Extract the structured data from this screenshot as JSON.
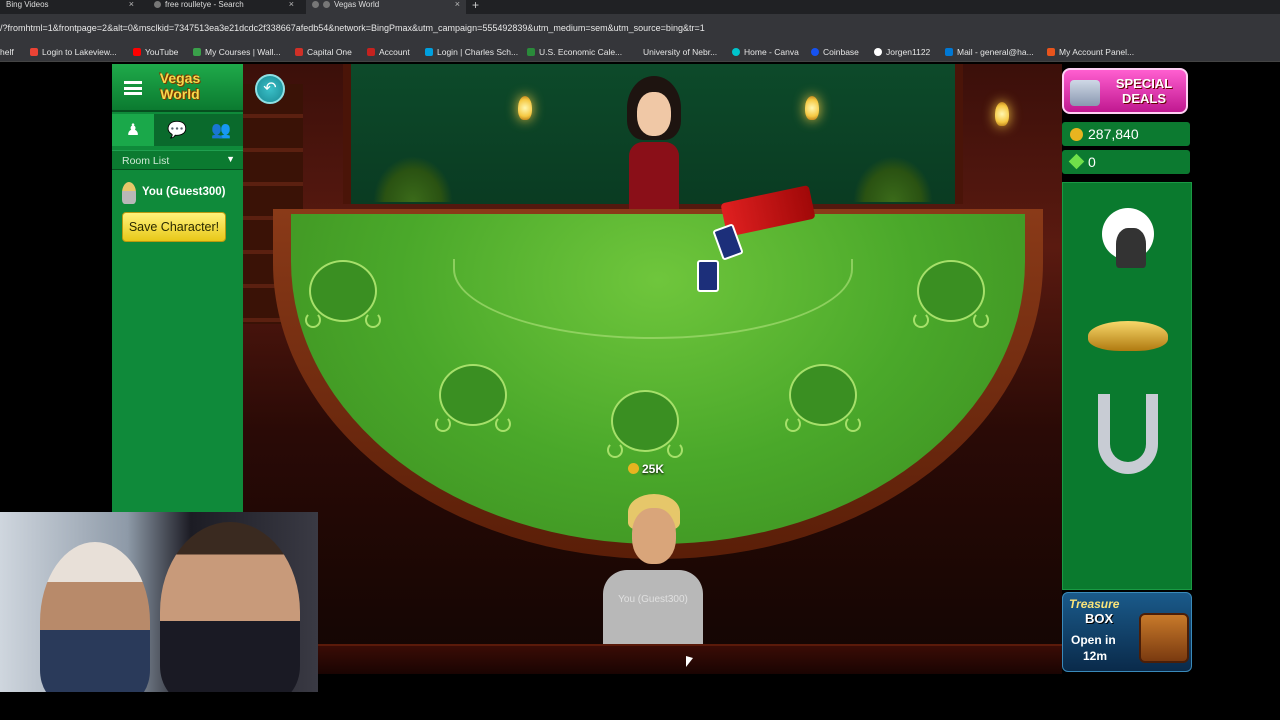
{
  "browser": {
    "tabs": [
      {
        "title": "Bing Videos"
      },
      {
        "title": "free roulletye - Search"
      },
      {
        "title": "Vegas World",
        "active": true
      }
    ],
    "new_tab": "+",
    "url": "/?fromhtml=1&frontpage=2&alt=0&msclkid=7347513ea3e21dcdc2f338667afedb54&network=BingPmax&utm_campaign=555492839&utm_medium=sem&utm_source=bing&tr=1",
    "bookmarks": [
      {
        "label": "helf"
      },
      {
        "label": "Login to Lakeview..."
      },
      {
        "label": "YouTube"
      },
      {
        "label": "My Courses | Wall..."
      },
      {
        "label": "Capital One"
      },
      {
        "label": "Account"
      },
      {
        "label": "Login | Charles Sch..."
      },
      {
        "label": "U.S. Economic Cale..."
      },
      {
        "label": "University of Nebr..."
      },
      {
        "label": "Home - Canva"
      },
      {
        "label": "Coinbase"
      },
      {
        "label": "Jorgen1122"
      },
      {
        "label": "Mail - general@ha..."
      },
      {
        "label": "My Account Panel..."
      }
    ]
  },
  "left_panel": {
    "logo": "Vegas World",
    "room_list": "Room List",
    "username": "You (Guest300)",
    "save_button": "Save Character!"
  },
  "table": {
    "bet": "25K",
    "player_name": "You (Guest300)"
  },
  "right_panel": {
    "deals": "SPECIAL DEALS",
    "coins": "287,840",
    "gems": "0",
    "items": [
      "moon-wolf-icon",
      "genie-lamp-icon",
      "horseshoe-icon"
    ],
    "treasure": {
      "title": "Treasure",
      "subtitle": "BOX",
      "open_label": "Open in",
      "time": "12m"
    }
  },
  "colors": {
    "felt": "#4aa82a",
    "panel_green": "#0f8a3a",
    "deals_pink": "#e02ca8",
    "gold": "#e8b420"
  }
}
